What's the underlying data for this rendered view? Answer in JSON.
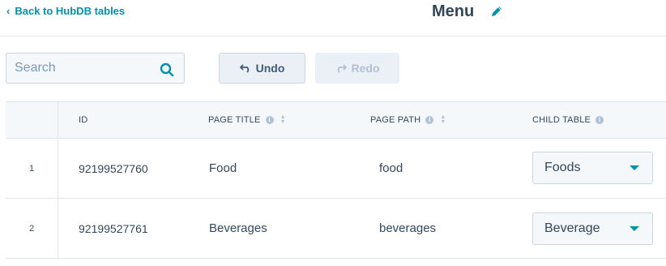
{
  "header": {
    "back_label": "Back to HubDB tables",
    "title": "Menu"
  },
  "search": {
    "placeholder": "Search",
    "value": ""
  },
  "toolbar": {
    "undo_label": "Undo",
    "redo_label": "Redo"
  },
  "table": {
    "columns": [
      "ID",
      "PAGE TITLE",
      "PAGE PATH",
      "CHILD TABLE"
    ],
    "rows": [
      {
        "num": "1",
        "id": "92199527760",
        "title": "Food",
        "path": "food",
        "child": "Foods"
      },
      {
        "num": "2",
        "id": "92199527761",
        "title": "Beverages",
        "path": "beverages",
        "child": "Beverage"
      }
    ]
  },
  "colors": {
    "accent": "#0091ae",
    "text": "#33475b",
    "border": "#dfe3eb",
    "header_bg": "#f5f8fa"
  },
  "icons": [
    "chevron-left-icon",
    "pencil-icon",
    "search-icon",
    "undo-icon",
    "redo-icon",
    "info-icon",
    "sort-icon",
    "caret-down-icon"
  ]
}
